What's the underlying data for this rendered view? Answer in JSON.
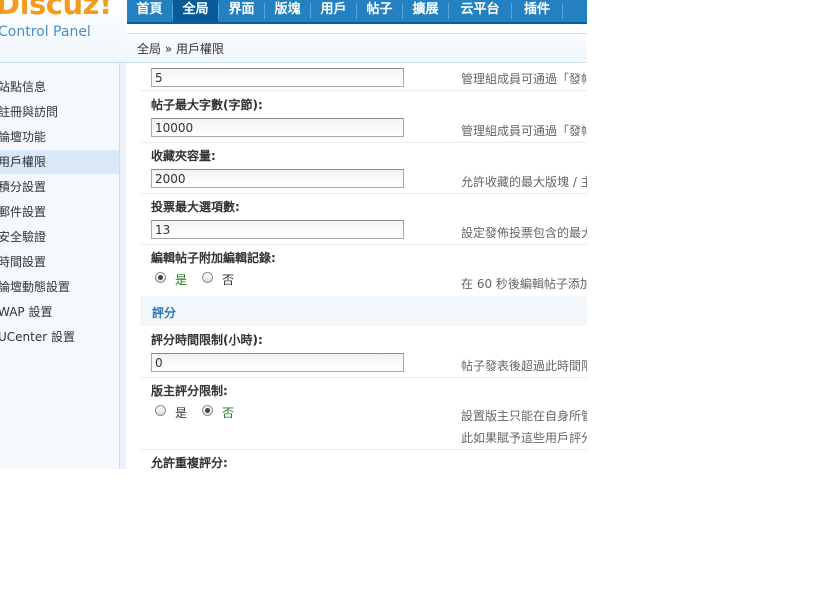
{
  "header": {
    "logo_text": "Discuz!",
    "logo_sub": "Control Panel",
    "nav": [
      "首頁",
      "全局",
      "界面",
      "版塊",
      "用戶",
      "帖子",
      "擴展",
      "云平台",
      "插件"
    ],
    "active_nav": "全局",
    "breadcrumb": "全局 » 用戶權限"
  },
  "sidebar": {
    "items": [
      {
        "label": "站點信息"
      },
      {
        "label": "註冊與訪問"
      },
      {
        "label": "論壇功能"
      },
      {
        "label": "用戶權限"
      },
      {
        "label": "積分設置"
      },
      {
        "label": "郵件設置"
      },
      {
        "label": "安全驗證"
      },
      {
        "label": "時間設置"
      },
      {
        "label": "論壇動態設置"
      },
      {
        "label": "WAP 設置"
      },
      {
        "label": "UCenter 設置"
      }
    ],
    "active": "用戶權限"
  },
  "form": {
    "top_field": {
      "value": "5",
      "tip": "管理組成員可通過「發帖"
    },
    "max_chars": {
      "label": "帖子最大字數(字節):",
      "value": "10000",
      "tip": "管理組成員可通過「發帖"
    },
    "fav_capacity": {
      "label": "收藏夾容量:",
      "value": "2000",
      "tip": "允許收藏的最大版塊 / 主"
    },
    "poll_options": {
      "label": "投票最大選項數:",
      "value": "13",
      "tip": "設定發佈投票包含的最大"
    },
    "edit_record": {
      "label": "編輯帖子附加編輯記錄:",
      "options": [
        "是",
        "否"
      ],
      "selected": "是",
      "tip": "在 60 秒後編輯帖子添加"
    },
    "section_title": "評分",
    "rate_time": {
      "label": "評分時間限制(小時):",
      "value": "0",
      "tip": "帖子發表後超過此時間限"
    },
    "mod_rate_limit": {
      "label": "版主評分限制:",
      "options": [
        "是",
        "否"
      ],
      "selected": "否",
      "tip_line1": "設置版主只能在自身所管",
      "tip_line2": "此如果賦予這些用戶評分"
    },
    "allow_repeat": {
      "label": "允許重複評分:"
    }
  }
}
